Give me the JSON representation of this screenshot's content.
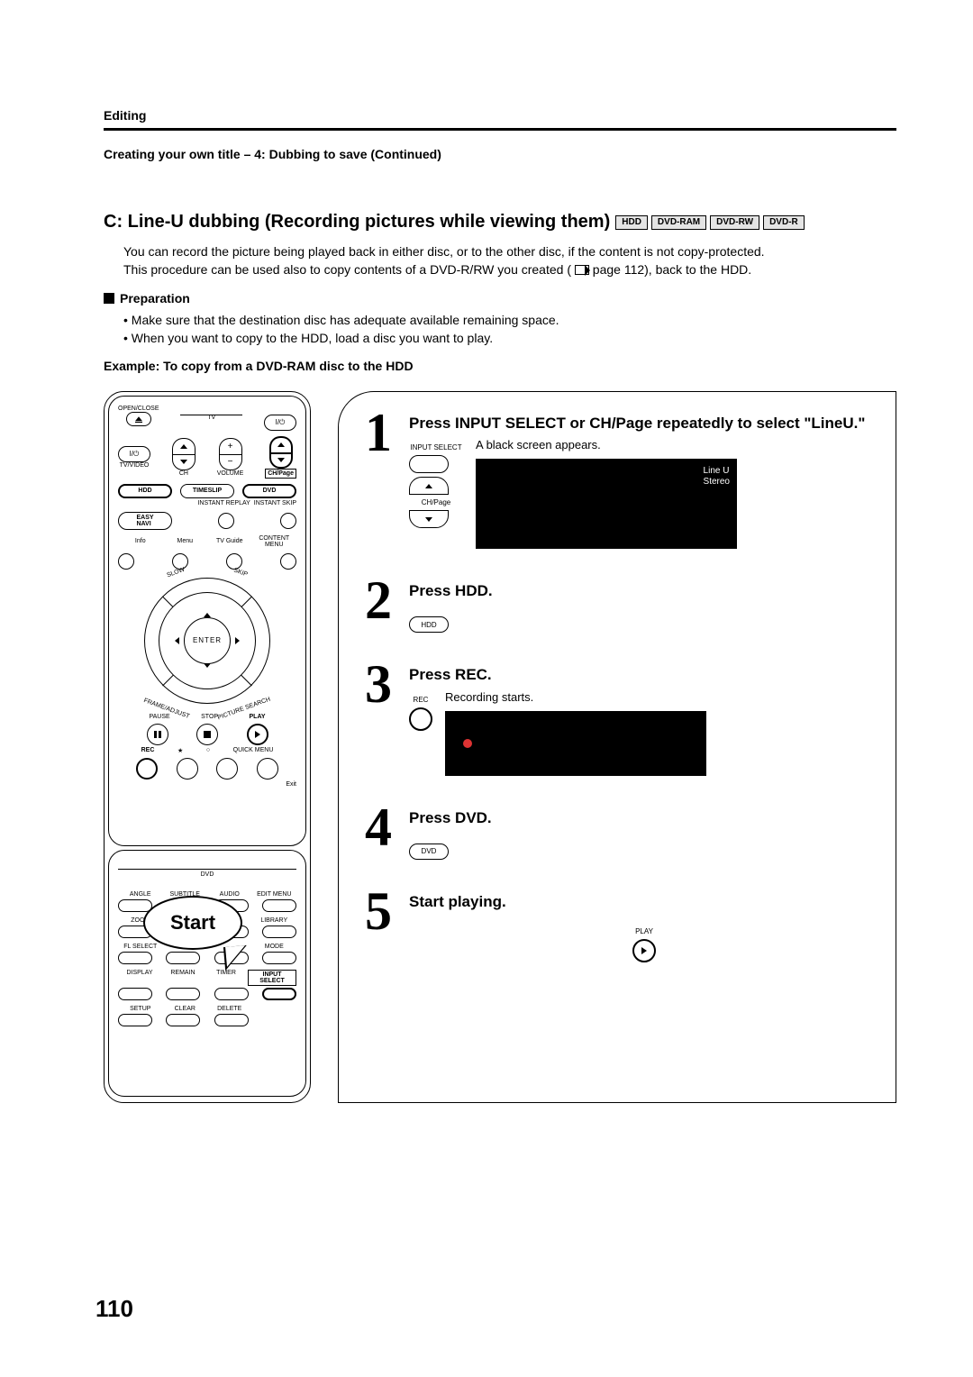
{
  "header": {
    "label": "Editing",
    "subtitle": "Creating your own title – 4: Dubbing to save (Continued)"
  },
  "section": {
    "title": "C: Line-U dubbing (Recording pictures while viewing them)",
    "badges": [
      "HDD",
      "DVD-RAM",
      "DVD-RW",
      "DVD-R"
    ],
    "intro1": "You can record the picture being played back in either disc, or to the other disc, if the content is not copy-protected.",
    "intro2a": "This procedure can be used also to copy contents of a DVD-R/RW you created (",
    "intro2b": " page 112), back to the HDD."
  },
  "prep": {
    "title": "Preparation",
    "items": [
      "Make sure that the destination disc has adequate available remaining space.",
      "When you want to copy to the HDD, load a disc you want to play."
    ]
  },
  "example": "Example: To copy from a DVD-RAM disc to the HDD",
  "remote": {
    "labels": {
      "openclose": "OPEN/CLOSE",
      "eject": "⏏",
      "tv": "TV",
      "power": "I/⏻",
      "tvvideo": "TV/VIDEO",
      "ch": "CH",
      "volume": "VOLUME",
      "chpage": "CH/Page",
      "hdd": "HDD",
      "timeslip": "TIMESLIP",
      "dvd": "DVD",
      "instreplay": "INSTANT REPLAY",
      "instskip": "INSTANT SKIP",
      "easynavi": "EASY\nNAVI",
      "menu": "Menu",
      "tvguide": "TV Guide",
      "info": "Info",
      "contentmenu": "CONTENT MENU",
      "slow": "SLOW",
      "skip": "SKIP",
      "enter": "ENTER",
      "frame": "FRAME/ADJUST",
      "picsearch": "PICTURE SEARCH",
      "pause": "PAUSE",
      "stop": "STOP",
      "play": "PLAY",
      "rec": "REC",
      "fav": "★",
      "loop": "○",
      "quickmenu": "QUICK MENU",
      "exit": "Exit",
      "dvdsection": "DVD",
      "angle": "ANGLE",
      "subtitle": "SUBTITLE",
      "audio": "AUDIO",
      "editmenu": "EDIT MENU",
      "zoom": "ZOOM",
      "library": "LIBRARY",
      "flselect": "FL SELECT",
      "mode": "MODE",
      "display": "DISPLAY",
      "remain": "REMAIN",
      "timer": "TIMER",
      "inputselect": "INPUT SELECT",
      "setup": "SETUP",
      "clear": "CLEAR",
      "delete": "DELETE",
      "start": "Start"
    }
  },
  "steps": {
    "s1": {
      "head": "Press INPUT SELECT or CH/Page repeatedly to select \"LineU.\"",
      "desc": "A black screen appears.",
      "ilab1": "INPUT SELECT",
      "ilab2": "CH/Page",
      "scr1": "Line U",
      "scr2": "Stereo"
    },
    "s2": {
      "head": "Press HDD.",
      "ilab": "HDD"
    },
    "s3": {
      "head": "Press REC.",
      "desc": "Recording starts.",
      "ilab": "REC"
    },
    "s4": {
      "head": "Press DVD.",
      "ilab": "DVD"
    },
    "s5": {
      "head": "Start playing.",
      "ilab": "PLAY"
    }
  },
  "pagenum": "110"
}
